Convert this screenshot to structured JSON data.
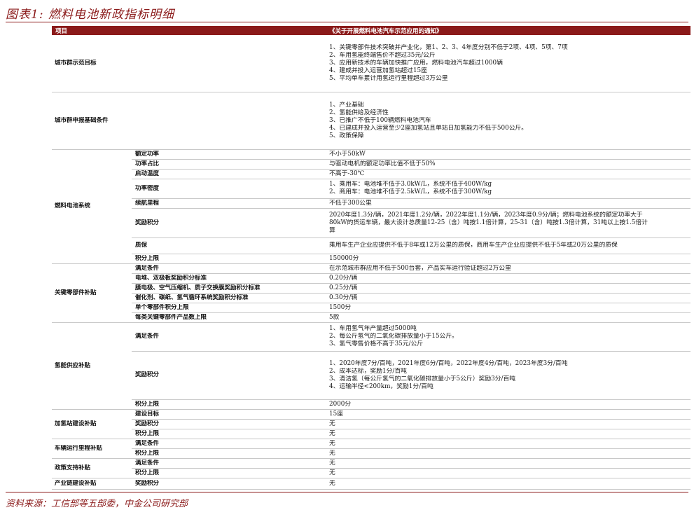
{
  "title": "图表1: 燃料电池新政指标明细",
  "header": {
    "col1": "项目",
    "col3": "《关于开展燃料电池汽车示范应用的通知》"
  },
  "rows": [
    {
      "cat": "城市群示范目标",
      "sub": "",
      "lines": [
        "1、关键零部件技术突破并产业化，第1、2、3、4年度分别不低于2项、4项、5项、7项",
        "2、车用氢能终端售价不超过35元/公斤",
        "3、应用新技术的车辆加快推广应用，燃料电池汽车超过1000辆",
        "4、建成并投入运营加氢站超过15座",
        "5、平均单车累计用氢运行里程超过3万公里"
      ]
    },
    {
      "cat": "城市群申报基础条件",
      "sub": "",
      "lines": [
        "1、产业基础",
        "2、氢能供给及经济性",
        "3、已推广不低于100辆燃料电池汽车",
        "4、已建成并投入运营至少2座加氢站且单站日加氢能力不低于500公斤。",
        "5、政策保障"
      ]
    },
    {
      "cat": "燃料电池系统",
      "sub": "额定功率",
      "lines": [
        "不小于50kW"
      ]
    },
    {
      "cat": "",
      "sub": "功率占比",
      "lines": [
        "与驱动电机的额定功率比值不低于50%"
      ]
    },
    {
      "cat": "",
      "sub": "启动温度",
      "lines": [
        "不高于-30℃"
      ]
    },
    {
      "cat": "",
      "sub": "功率密度",
      "lines": [
        "1、乘用车：电池堆不低于3.0kW/L，系统不低于400W/kg",
        "2、商用车：电池堆不低于2.5kW/L，系统不低于300W/kg"
      ]
    },
    {
      "cat": "",
      "sub": "续航里程",
      "lines": [
        "不低于300公里"
      ]
    },
    {
      "cat": "",
      "sub": "奖励积分",
      "lines": [
        "2020年度1.3分/辆，2021年度1.2分/辆，2022年度1.1分/辆，2023年度0.9分/辆；燃料电池系统的额定功率大于",
        "80kW的货运车辆，最大设计总质量12-25（含）吨按1.1倍计算，25-31（含）吨按1.3倍计算，31吨以上按1.5倍计",
        "算"
      ]
    },
    {
      "cat": "",
      "sub": "质保",
      "lines": [
        "乘用车生产企业应提供不低于8年或12万公里的质保，商用车生产企业应提供不低于5年或20万公里的质保"
      ]
    },
    {
      "cat": "",
      "sub": "积分上限",
      "lines": [
        "150000分"
      ]
    },
    {
      "cat": "关键零部件补贴",
      "sub": "满足条件",
      "lines": [
        "在示范城市群应用不低于500台套，产品实车运行验证超过2万公里"
      ]
    },
    {
      "cat": "",
      "sub": "电堆、双极板奖励积分标准",
      "lines": [
        "0.20分/辆"
      ]
    },
    {
      "cat": "",
      "sub": "膜电极、空气压缩机、质子交换膜奖励积分标准",
      "lines": [
        "0.25分/辆"
      ]
    },
    {
      "cat": "",
      "sub": "催化剂、碳纸、氢气循环系统奖励积分标准",
      "lines": [
        "0.30分/辆"
      ]
    },
    {
      "cat": "",
      "sub": "单个零部件积分上限",
      "lines": [
        "1500分"
      ]
    },
    {
      "cat": "",
      "sub": "每类关键零部件产品数上限",
      "lines": [
        "5款"
      ]
    },
    {
      "cat": "氢能供应补贴",
      "sub": "满足条件",
      "lines": [
        "1、车用氢气年产量超过5000吨",
        "2、每公斤氢气的二氧化碳排放量小于15公斤。",
        "3、氢气零售价格不高于35元/公斤"
      ]
    },
    {
      "cat": "",
      "sub": "奖励积分",
      "lines": [
        "1、2020年度7分/百吨，2021年度6分/百吨，2022年度4分/百吨，2023年度3分/百吨",
        "2、成本达标，奖励1分/百吨",
        "3、清洁氢（每公斤氢气的二氧化碳排放量小于5公斤）奖励3分/百吨",
        "4、运输半径<200km，奖励1分/百吨"
      ]
    },
    {
      "cat": "",
      "sub": "积分上限",
      "lines": [
        "2000分"
      ]
    },
    {
      "cat": "加氢站建设补贴",
      "sub": "建设目标",
      "lines": [
        "15座"
      ]
    },
    {
      "cat": "",
      "sub": "奖励积分",
      "lines": [
        "无"
      ]
    },
    {
      "cat": "",
      "sub": "积分上限",
      "lines": [
        "无"
      ]
    },
    {
      "cat": "车辆运行里程补贴",
      "sub": "满足条件",
      "lines": [
        "无"
      ]
    },
    {
      "cat": "",
      "sub": "积分上限",
      "lines": [
        "无"
      ]
    },
    {
      "cat": "政策支持补贴",
      "sub": "满足条件",
      "lines": [
        "无"
      ]
    },
    {
      "cat": "",
      "sub": "积分上限",
      "lines": [
        "无"
      ]
    },
    {
      "cat": "产业链建设补贴",
      "sub": "奖励积分",
      "lines": [
        "无"
      ]
    }
  ],
  "source": "资料来源：工信部等五部委，中金公司研究部",
  "colors": {
    "accent": "#8b1a1a"
  }
}
